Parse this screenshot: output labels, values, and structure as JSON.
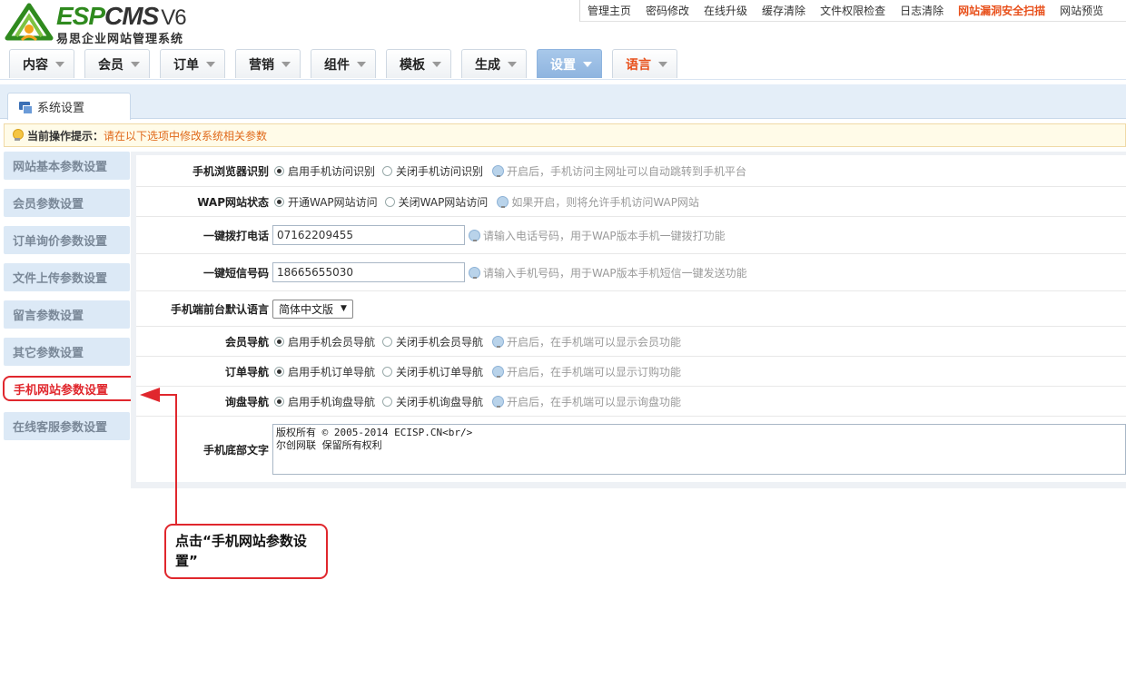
{
  "brand": {
    "logo_esp": "ESP",
    "logo_cms": "CMS",
    "logo_version": "V6",
    "subtitle": "易思企业网站管理系统"
  },
  "topnav": [
    {
      "label": "管理主页"
    },
    {
      "label": "密码修改"
    },
    {
      "label": "在线升级"
    },
    {
      "label": "缓存清除"
    },
    {
      "label": "文件权限检查"
    },
    {
      "label": "日志清除"
    },
    {
      "label": "网站漏洞安全扫描"
    },
    {
      "label": "网站预览"
    }
  ],
  "menu": [
    {
      "label": "内容"
    },
    {
      "label": "会员"
    },
    {
      "label": "订单"
    },
    {
      "label": "营销"
    },
    {
      "label": "组件"
    },
    {
      "label": "模板"
    },
    {
      "label": "生成"
    },
    {
      "label": "设置"
    },
    {
      "label": "语言"
    }
  ],
  "tab": {
    "label": "系统设置"
  },
  "tip": {
    "label": "当前操作提示：",
    "text": "请在以下选项中修改系统相关参数"
  },
  "sidebar": [
    {
      "label": "网站基本参数设置"
    },
    {
      "label": "会员参数设置"
    },
    {
      "label": "订单询价参数设置"
    },
    {
      "label": "文件上传参数设置"
    },
    {
      "label": "留言参数设置"
    },
    {
      "label": "其它参数设置"
    },
    {
      "label": "手机网站参数设置"
    },
    {
      "label": "在线客服参数设置"
    }
  ],
  "form": {
    "browser": {
      "label": "手机浏览器识别",
      "opt_on": "启用手机访问识别",
      "opt_off": "关闭手机访问识别",
      "hint": "开启后，手机访问主网址可以自动跳转到手机平台"
    },
    "wap": {
      "label": "WAP网站状态",
      "opt_on": "开通WAP网站访问",
      "opt_off": "关闭WAP网站访问",
      "hint": "如果开启，则将允许手机访问WAP网站"
    },
    "phone": {
      "label": "一键拨打电话",
      "value": "07162209455",
      "hint": "请输入电话号码，用于WAP版本手机一键拨打功能"
    },
    "sms": {
      "label": "一键短信号码",
      "value": "18665655030",
      "hint": "请输入手机号码，用于WAP版本手机短信一键发送功能"
    },
    "lang": {
      "label": "手机端前台默认语言",
      "selected": "简体中文版",
      "arrow": "▼"
    },
    "member_nav": {
      "label": "会员导航",
      "opt_on": "启用手机会员导航",
      "opt_off": "关闭手机会员导航",
      "hint": "开启后，在手机端可以显示会员功能"
    },
    "order_nav": {
      "label": "订单导航",
      "opt_on": "启用手机订单导航",
      "opt_off": "关闭手机订单导航",
      "hint": "开启后，在手机端可以显示订购功能"
    },
    "inquiry_nav": {
      "label": "询盘导航",
      "opt_on": "启用手机询盘导航",
      "opt_off": "关闭手机询盘导航",
      "hint": "开启后，在手机端可以显示询盘功能"
    },
    "footer": {
      "label": "手机底部文字",
      "value": "版权所有 © 2005-2014 ECISP.CN<br/>\n尔创网联 保留所有权利"
    }
  },
  "annotation": {
    "text": "点击“手机网站参数设置”"
  },
  "colors": {
    "accent_red": "#e0272d",
    "menu_active": "#8eb4df",
    "warn_orange": "#e8501b"
  }
}
